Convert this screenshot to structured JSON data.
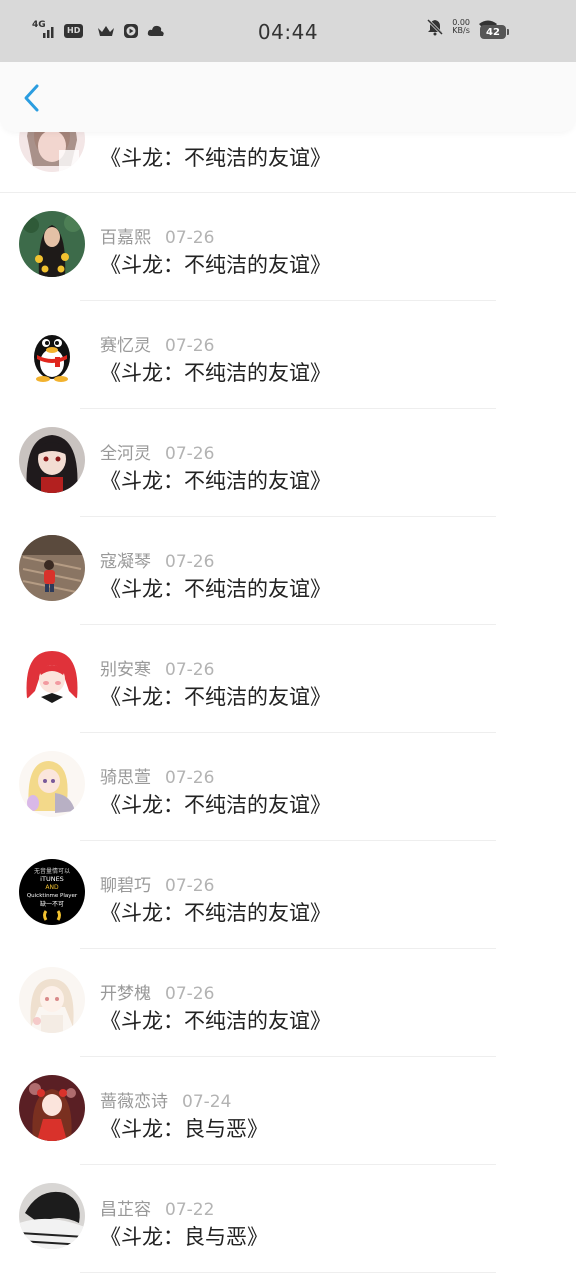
{
  "status_bar": {
    "network": "4G",
    "hd": "HD",
    "time": "04:44",
    "speed_value": "0.00",
    "speed_unit": "KB/s",
    "battery": "42"
  },
  "nav": {
    "back_icon": "chevron-left-icon",
    "accent_color": "#2a9de0"
  },
  "items": [
    {
      "name": "",
      "date": "",
      "title": "《斗龙：不纯洁的友谊》",
      "avatar": "girl-photo"
    },
    {
      "name": "百嘉熙",
      "date": "07-26",
      "title": "《斗龙：不纯洁的友谊》",
      "avatar": "girl-sunflower"
    },
    {
      "name": "赛忆灵",
      "date": "07-26",
      "title": "《斗龙：不纯洁的友谊》",
      "avatar": "qq-penguin"
    },
    {
      "name": "全河灵",
      "date": "07-26",
      "title": "《斗龙：不纯洁的友谊》",
      "avatar": "anime-dark-hair"
    },
    {
      "name": "寇凝琴",
      "date": "07-26",
      "title": "《斗龙：不纯洁的友谊》",
      "avatar": "child-photo"
    },
    {
      "name": "别安寒",
      "date": "07-26",
      "title": "《斗龙：不纯洁的友谊》",
      "avatar": "anime-red-hair"
    },
    {
      "name": "骑思萱",
      "date": "07-26",
      "title": "《斗龙：不纯洁的友谊》",
      "avatar": "anime-blonde"
    },
    {
      "name": "聊碧巧",
      "date": "07-26",
      "title": "《斗龙：不纯洁的友谊》",
      "avatar": "itunes-text"
    },
    {
      "name": "开梦槐",
      "date": "07-26",
      "title": "《斗龙：不纯洁的友谊》",
      "avatar": "anime-sketch"
    },
    {
      "name": "蔷薇恋诗",
      "date": "07-24",
      "title": "《斗龙：良与恶》",
      "avatar": "anime-red-dress"
    },
    {
      "name": "昌芷容",
      "date": "07-22",
      "title": "《斗龙：良与恶》",
      "avatar": "cat-photo"
    }
  ],
  "avatar_texts": {
    "itunes": {
      "line1": "无音量情可以",
      "line2": "iTUNES",
      "line3": "AND",
      "line4": "Quicktinme Player",
      "line5": "缺一不可"
    }
  }
}
